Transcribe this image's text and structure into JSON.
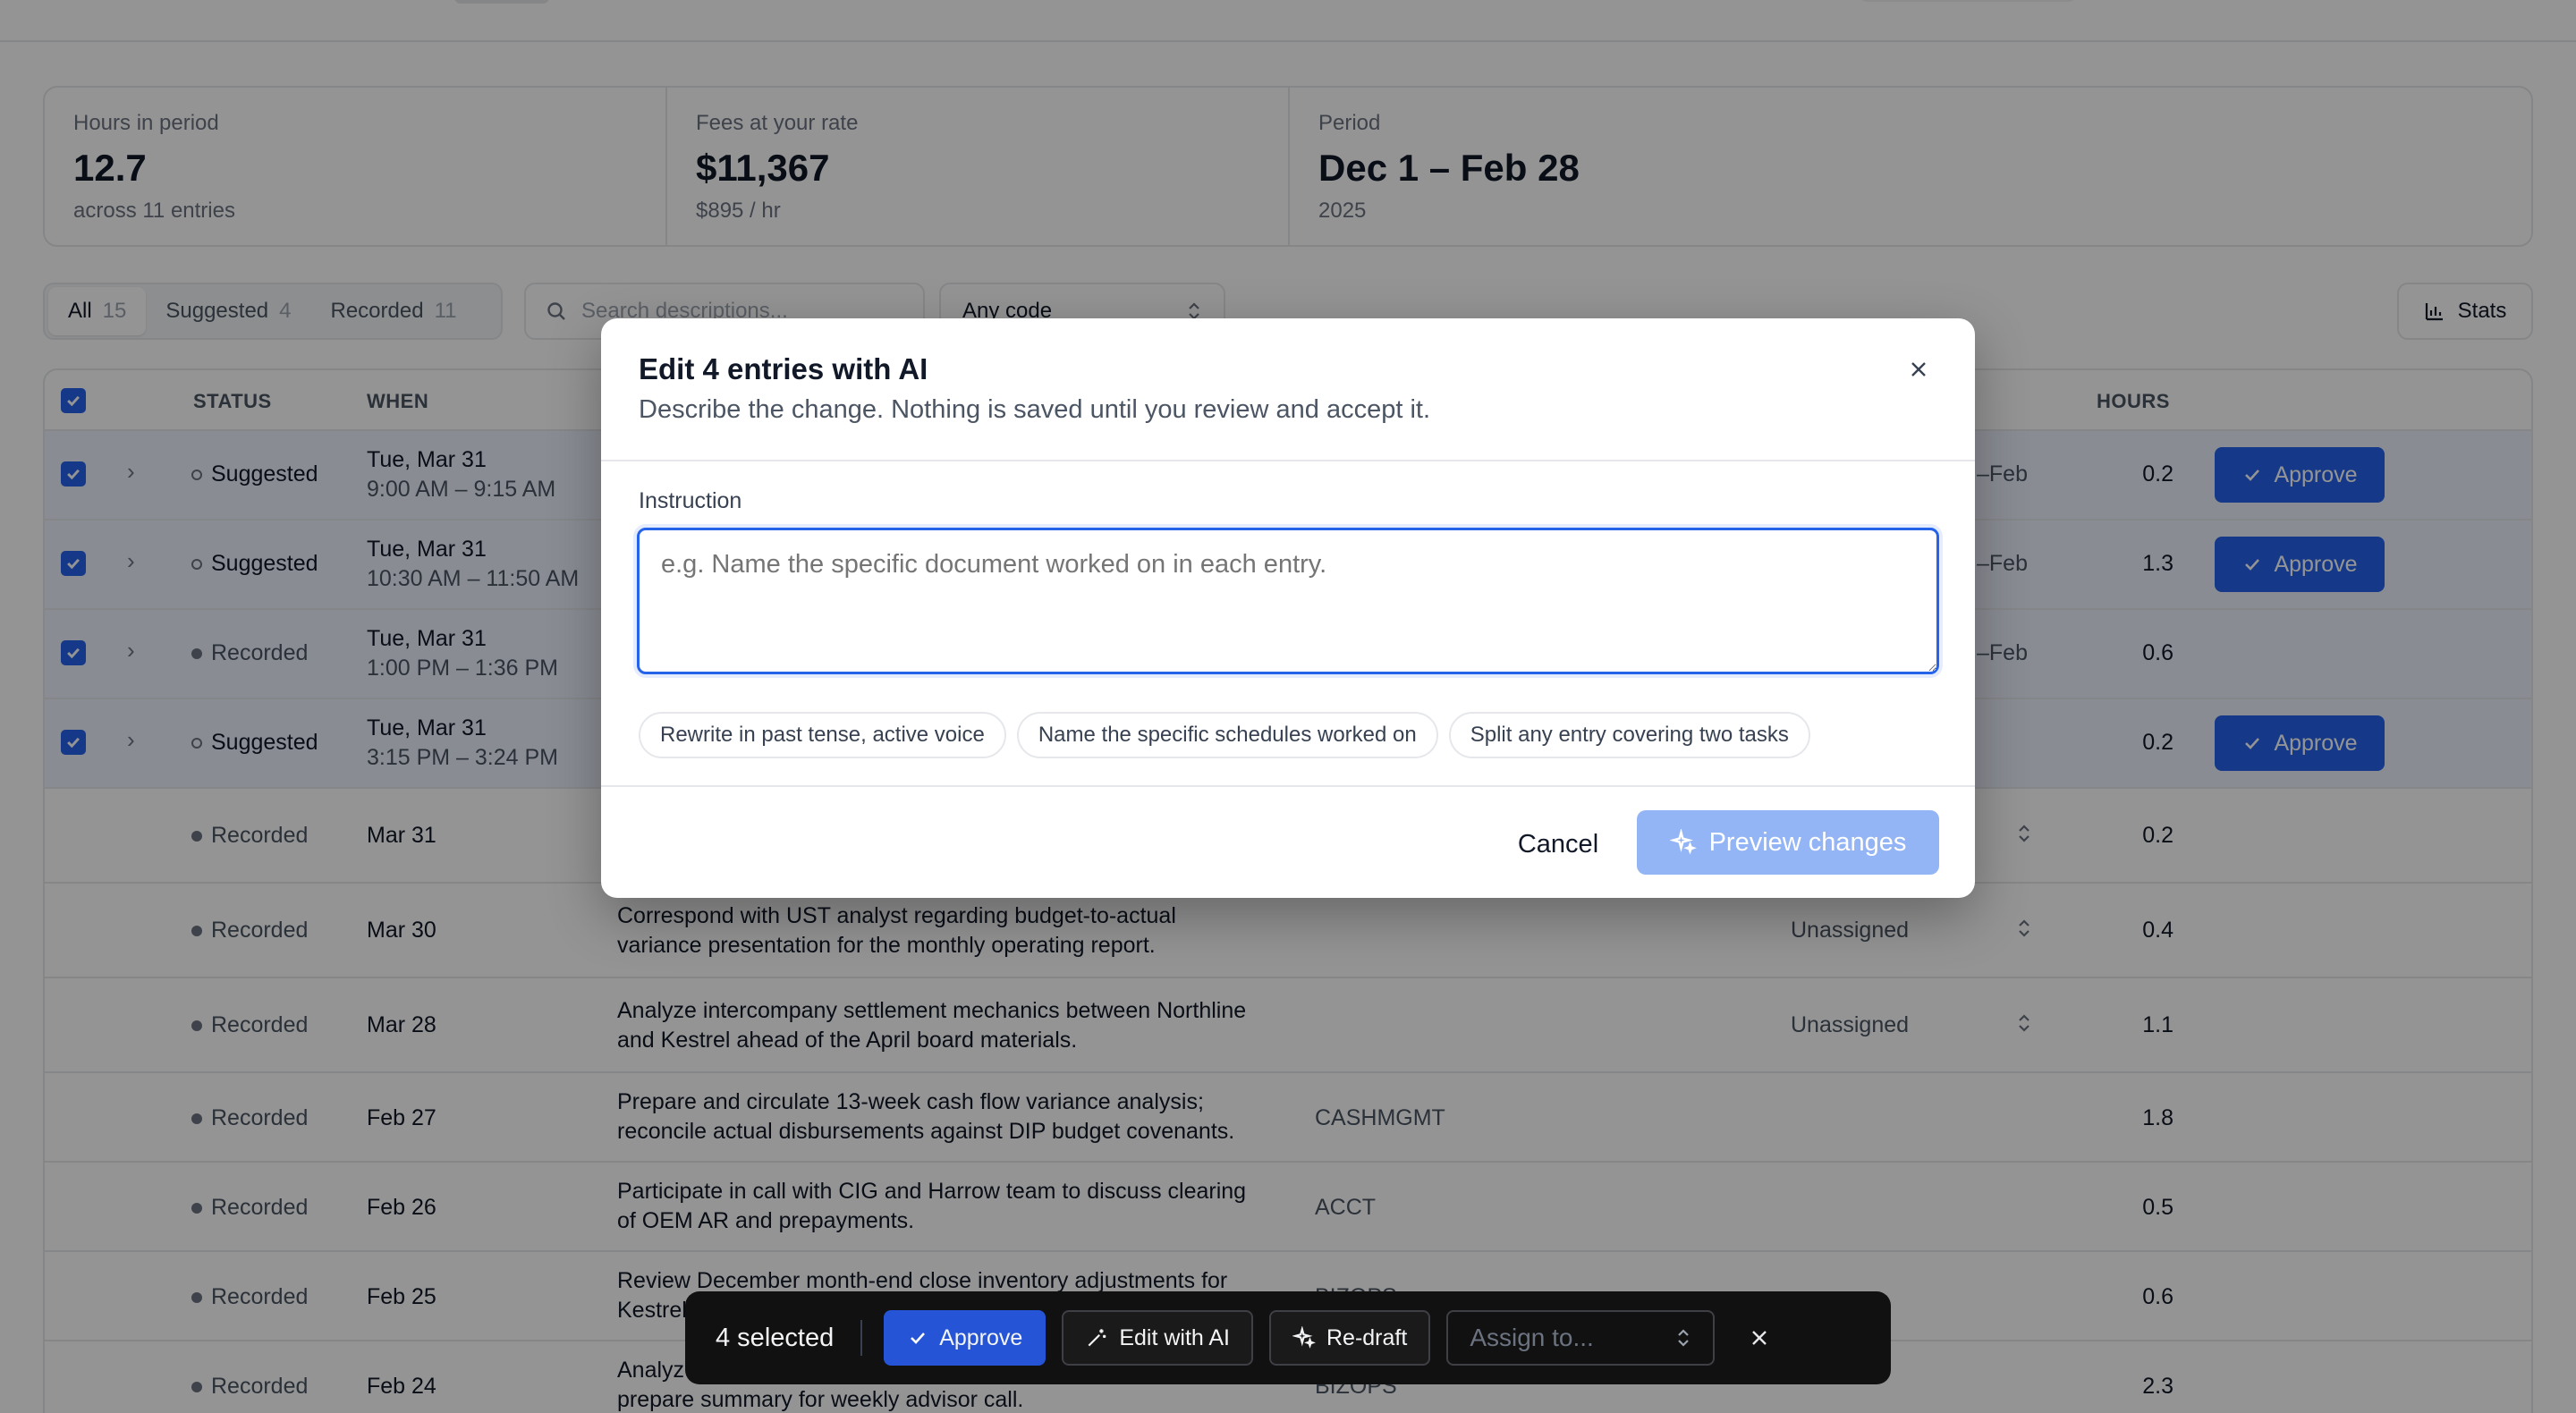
{
  "stats": [
    {
      "label": "Hours in period",
      "value": "12.7",
      "sub": "across 11 entries"
    },
    {
      "label": "Fees at your rate",
      "value": "$11,367",
      "sub": "$895 / hr"
    },
    {
      "label": "Period",
      "value": "Dec 1 – Feb 28",
      "sub": "2025"
    }
  ],
  "filters": {
    "tabs": [
      {
        "label": "All",
        "count": "15"
      },
      {
        "label": "Suggested",
        "count": "4"
      },
      {
        "label": "Recorded",
        "count": "11"
      }
    ],
    "search_placeholder": "Search descriptions...",
    "code_select": "Any code",
    "stats_button": "Stats"
  },
  "table": {
    "headers": {
      "status": "STATUS",
      "when": "WHEN",
      "hours": "HOURS"
    },
    "approve_label": "Approve",
    "selected_rows": [
      {
        "status": "Suggested",
        "date": "Tue, Mar 31",
        "time": "9:00 AM – 9:15 AM",
        "partial": "–Feb",
        "hours": "0.2"
      },
      {
        "status": "Suggested",
        "date": "Tue, Mar 31",
        "time": "10:30 AM – 11:50 AM",
        "partial": "–Feb",
        "hours": "1.3"
      },
      {
        "status": "Recorded",
        "date": "Tue, Mar 31",
        "time": "1:00 PM – 1:36 PM",
        "partial": "–Feb",
        "hours": "0.6"
      },
      {
        "status": "Suggested",
        "date": "Tue, Mar 31",
        "time": "3:15 PM – 3:24 PM",
        "partial": "",
        "hours": "0.2"
      }
    ],
    "rows": [
      {
        "status": "Recorded",
        "date": "Mar 31",
        "desc1": "",
        "desc2": "",
        "code": "",
        "assign": "",
        "hours": "0.2"
      },
      {
        "status": "Recorded",
        "date": "Mar 30",
        "desc1": "Correspond with UST analyst regarding budget-to-actual",
        "desc2": "variance presentation for the monthly operating report.",
        "code": "",
        "assign": "Unassigned",
        "hours": "0.4"
      },
      {
        "status": "Recorded",
        "date": "Mar 28",
        "desc1": "Analyze intercompany settlement mechanics between Northline",
        "desc2": "and Kestrel ahead of the April board materials.",
        "code": "",
        "assign": "Unassigned",
        "hours": "1.1"
      },
      {
        "status": "Recorded",
        "date": "Feb 27",
        "desc1": "Prepare and circulate 13-week cash flow variance analysis;",
        "desc2": "reconcile actual disbursements against DIP budget covenants.",
        "code": "CASHMGMT",
        "assign": "",
        "hours": "1.8"
      },
      {
        "status": "Recorded",
        "date": "Feb 26",
        "desc1": "Participate in call with CIG and Harrow team to discuss clearing",
        "desc2": "of OEM AR and prepayments.",
        "code": "ACCT",
        "assign": "",
        "hours": "0.5"
      },
      {
        "status": "Recorded",
        "date": "Feb 25",
        "desc1": "Review December month-end close inventory adjustments for",
        "desc2": "Kestrel",
        "code": "BIZOPS",
        "assign": "",
        "hours": "0.6"
      },
      {
        "status": "Recorded",
        "date": "Feb 24",
        "desc1": "Analyz",
        "desc2": "prepare summary for weekly advisor call.",
        "code": "BIZOPS",
        "assign": "",
        "hours": "2.3"
      }
    ]
  },
  "modal": {
    "title": "Edit 4 entries with AI",
    "subtitle": "Describe the change. Nothing is saved until you review and accept it.",
    "field_label": "Instruction",
    "placeholder": "e.g. Name the specific document worked on in each entry.",
    "chips": [
      "Rewrite in past tense, active voice",
      "Name the specific schedules worked on",
      "Split any entry covering two tasks"
    ],
    "cancel_label": "Cancel",
    "preview_label": "Preview changes"
  },
  "bulkbar": {
    "count": "4 selected",
    "approve": "Approve",
    "edit_ai": "Edit with AI",
    "redraft": "Re-draft",
    "assign_placeholder": "Assign to..."
  },
  "colors": {
    "accent": "#2563eb",
    "preview_disabled": "#93b4f5",
    "bulkbar_bg": "#111111",
    "selected_row": "#eef2ff"
  }
}
